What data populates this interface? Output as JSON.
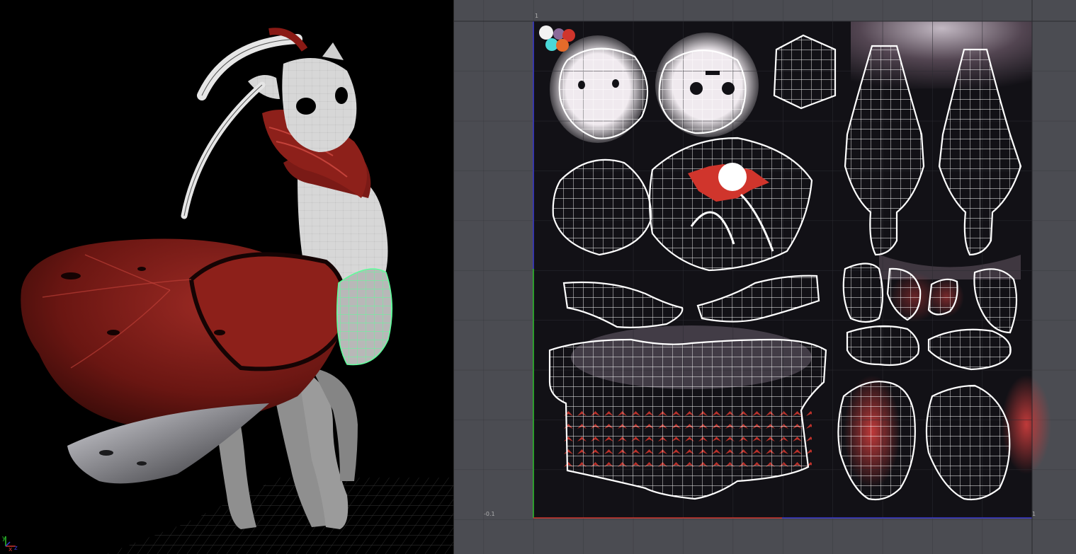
{
  "viewport": {
    "axis": {
      "y": "y",
      "x": "x",
      "z": "z"
    }
  },
  "uv_editor": {
    "ticks": {
      "top_left": "1",
      "bottom_left": "-0.1",
      "bottom_right": "1"
    }
  },
  "colors": {
    "uv_background": "#4b4c52",
    "texture_background": "#121116",
    "wire": "#ffffff",
    "accent_red": "#d0352c",
    "selection_green": "#5dff9a",
    "axis_blue": "#3a3ad0",
    "axis_green": "#2cc22c"
  }
}
